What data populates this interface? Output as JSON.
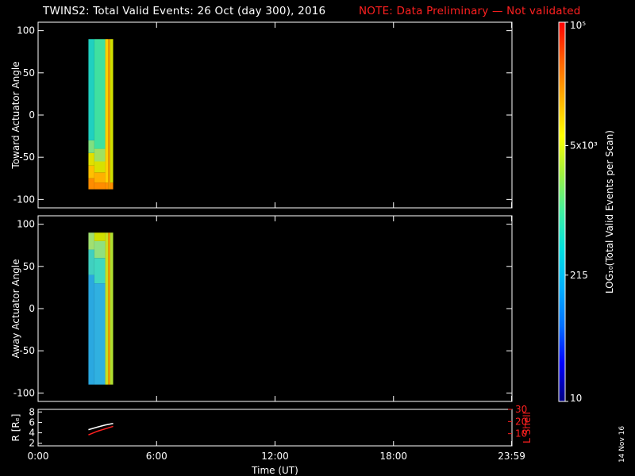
{
  "title": {
    "main": "TWINS2: Total Valid Events: 26 Oct (day 300), 2016",
    "note": "NOTE: Data Preliminary — Not validated",
    "note_color": "#ff2020"
  },
  "date_stamp": "14 Nov 16",
  "colors": {
    "background": "#000000",
    "axis": "#ffffff",
    "lshell": "#ff2020"
  },
  "chart_data": [
    {
      "type": "heatmap",
      "panel": "toward",
      "ylabel": "Toward Actuator Angle",
      "ylim": [
        -110,
        110
      ],
      "yticks": [
        -100,
        -50,
        0,
        50,
        100
      ],
      "xlim": [
        0,
        24
      ],
      "x_range": [
        2.55,
        3.8
      ],
      "y_range": [
        -88,
        90
      ],
      "colorscale_log": true,
      "description_cells": [
        {
          "x0": 2.55,
          "x1": 2.85,
          "y0": -88,
          "y1": 90,
          "rows": [
            [
              -88,
              -75,
              "#ff8c00"
            ],
            [
              -75,
              -60,
              "#ffc000"
            ],
            [
              -60,
              -45,
              "#e0e000"
            ],
            [
              -45,
              -30,
              "#80e080"
            ],
            [
              -30,
              90,
              "#20d0c0"
            ]
          ]
        },
        {
          "x0": 2.85,
          "x1": 3.4,
          "y0": -88,
          "y1": 90,
          "rows": [
            [
              -88,
              -80,
              "#ff8c00"
            ],
            [
              -80,
              -68,
              "#ffb000"
            ],
            [
              -68,
              -55,
              "#d8e000"
            ],
            [
              -55,
              -40,
              "#a0e060"
            ],
            [
              -40,
              90,
              "#40e0a0"
            ]
          ]
        },
        {
          "x0": 3.4,
          "x1": 3.55,
          "y0": -88,
          "y1": 90,
          "rows": [
            [
              -88,
              -80,
              "#ff9000"
            ],
            [
              -80,
              90,
              "#ffd000"
            ]
          ]
        },
        {
          "x0": 3.55,
          "x1": 3.65,
          "y0": -88,
          "y1": 90,
          "rows": [
            [
              -88,
              90,
              "#ffa000"
            ]
          ]
        },
        {
          "x0": 3.65,
          "x1": 3.8,
          "y0": -88,
          "y1": 90,
          "rows": [
            [
              -88,
              -80,
              "#ff9000"
            ],
            [
              -80,
              90,
              "#d0e000"
            ]
          ]
        }
      ]
    },
    {
      "type": "heatmap",
      "panel": "away",
      "ylabel": "Away Actuator Angle",
      "ylim": [
        -110,
        110
      ],
      "yticks": [
        -100,
        -50,
        0,
        50,
        100
      ],
      "xlim": [
        0,
        24
      ],
      "x_range": [
        2.55,
        3.8
      ],
      "y_range": [
        -90,
        90
      ],
      "colorscale_log": true,
      "description_cells": [
        {
          "x0": 2.55,
          "x1": 2.85,
          "y0": -90,
          "y1": 90,
          "rows": [
            [
              -90,
              40,
              "#2aa8e0"
            ],
            [
              40,
              70,
              "#40d0c0"
            ],
            [
              70,
              90,
              "#a0e070"
            ]
          ]
        },
        {
          "x0": 2.85,
          "x1": 3.4,
          "y0": -90,
          "y1": 90,
          "rows": [
            [
              -90,
              30,
              "#30b0e0"
            ],
            [
              30,
              60,
              "#40d8c0"
            ],
            [
              60,
              80,
              "#90e080"
            ],
            [
              80,
              90,
              "#d0e000"
            ]
          ]
        },
        {
          "x0": 3.4,
          "x1": 3.55,
          "y0": -90,
          "y1": 90,
          "rows": [
            [
              -90,
              90,
              "#c8e020"
            ]
          ]
        },
        {
          "x0": 3.55,
          "x1": 3.65,
          "y0": -90,
          "y1": 90,
          "rows": [
            [
              -90,
              90,
              "#ffa000"
            ]
          ]
        },
        {
          "x0": 3.65,
          "x1": 3.8,
          "y0": -90,
          "y1": 90,
          "rows": [
            [
              -90,
              90,
              "#b0e030"
            ]
          ]
        }
      ]
    },
    {
      "type": "line",
      "panel": "orbit",
      "ylabel": "R [Rₑ]",
      "ylabel_right": "L Shell",
      "ylim": [
        1.5,
        8.5
      ],
      "yticks": [
        2,
        4,
        6,
        8
      ],
      "ylim_right": [
        0,
        30
      ],
      "yticks_right": [
        10,
        20,
        30
      ],
      "xlim": [
        0,
        24
      ],
      "xticks": [
        0,
        6,
        12,
        18,
        23.983
      ],
      "xticklabels": [
        "0:00",
        "6:00",
        "12:00",
        "18:00",
        "23:59"
      ],
      "xlabel": "Time (UT)",
      "series": [
        {
          "axis": "left",
          "color": "#ffffff",
          "x": [
            2.55,
            3.0,
            3.4,
            3.8
          ],
          "y": [
            4.6,
            5.1,
            5.5,
            5.8
          ]
        },
        {
          "axis": "right",
          "color": "#ff2020",
          "x": [
            2.55,
            3.0,
            3.4,
            3.8
          ],
          "y": [
            9,
            12,
            14,
            16
          ]
        }
      ]
    }
  ],
  "colorbar": {
    "label": "LOG₁₀(Total Valid Events per Scan)",
    "scale": "log",
    "range": [
      10,
      100000
    ],
    "ticks": [
      {
        "value": 100000,
        "label": "10⁵"
      },
      {
        "value": 5000,
        "label": "5x10³"
      },
      {
        "value": 215,
        "label": "215"
      },
      {
        "value": 10,
        "label": "10"
      }
    ],
    "stops": [
      "#000080",
      "#0000ff",
      "#0070ff",
      "#00b0ff",
      "#00e0e0",
      "#40f0a0",
      "#a0f040",
      "#ffff00",
      "#ffb000",
      "#ff6000",
      "#ff0000"
    ]
  }
}
